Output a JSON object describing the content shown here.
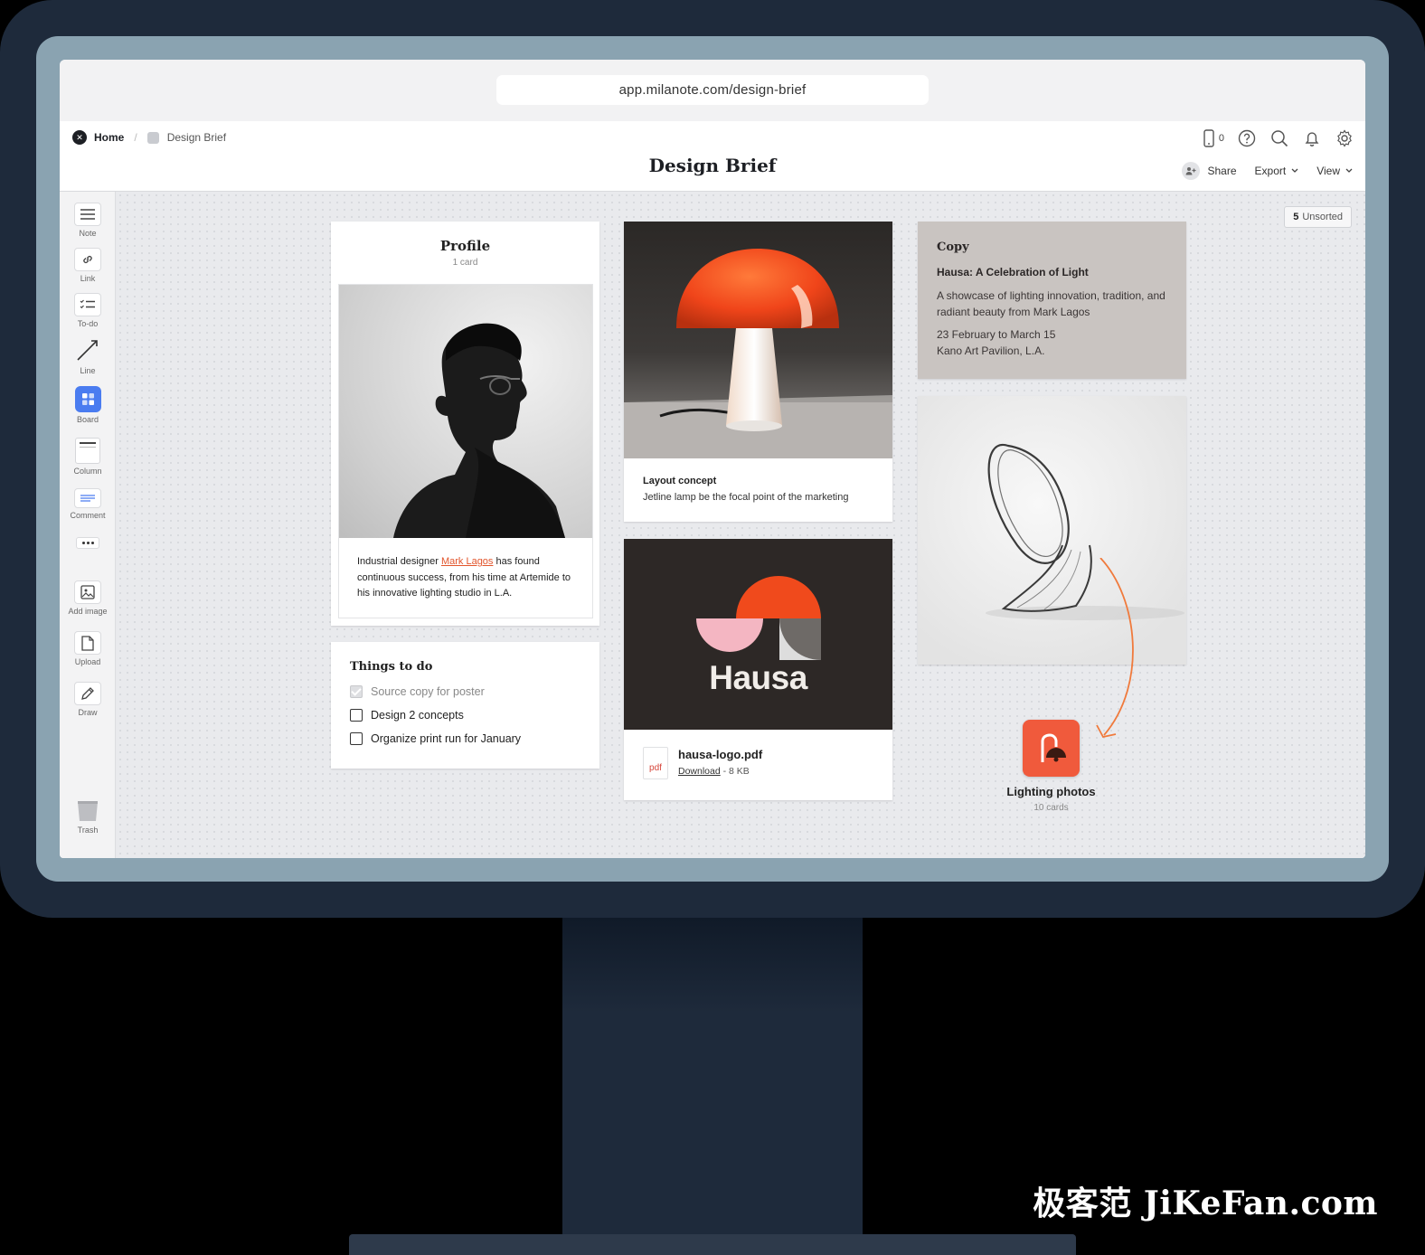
{
  "browser": {
    "url": "app.milanote.com/design-brief"
  },
  "breadcrumb": {
    "home": "Home",
    "current": "Design Brief"
  },
  "page_title": "Design Brief",
  "header": {
    "device_count": "0",
    "share": "Share",
    "export": "Export",
    "view": "View"
  },
  "sidebar": {
    "note": "Note",
    "link": "Link",
    "todo": "To-do",
    "line": "Line",
    "board": "Board",
    "column": "Column",
    "comment": "Comment",
    "add_image": "Add image",
    "upload": "Upload",
    "draw": "Draw",
    "trash": "Trash"
  },
  "unsorted": {
    "count": "5",
    "label": "Unsorted"
  },
  "profile": {
    "title": "Profile",
    "subtitle": "1 card",
    "text_before": "Industrial designer ",
    "link": "Mark Lagos",
    "text_after": " has found continuous success, from his time at Artemide to his innovative lighting studio in L.A."
  },
  "todo": {
    "title": "Things to do",
    "items": [
      {
        "label": "Source copy for poster",
        "done": true
      },
      {
        "label": "Design 2 concepts",
        "done": false
      },
      {
        "label": "Organize print run for January",
        "done": false
      }
    ]
  },
  "lamp": {
    "caption_title": "Layout concept",
    "caption_text": "Jetline lamp be the focal point of the marketing"
  },
  "hausa": {
    "logo_word": "Hausa",
    "file_name": "hausa-logo.pdf",
    "file_type": "pdf",
    "download": "Download",
    "size": " - 8 KB"
  },
  "copy": {
    "label": "Copy",
    "heading": "Hausa: A Celebration of Light",
    "body": "A showcase of lighting innovation, tradition, and radiant beauty from Mark Lagos",
    "date_line": "23 February to March 15",
    "venue_line": "Kano Art Pavilion, L.A."
  },
  "lighting_board": {
    "title": "Lighting photos",
    "count": "10 cards"
  },
  "watermark": "极客范 JiKeFan.com",
  "colors": {
    "accent": "#f05a3c",
    "board_blue": "#4a7cf0",
    "canvas": "#e9eaed",
    "monitor": "#1e2a3b"
  }
}
